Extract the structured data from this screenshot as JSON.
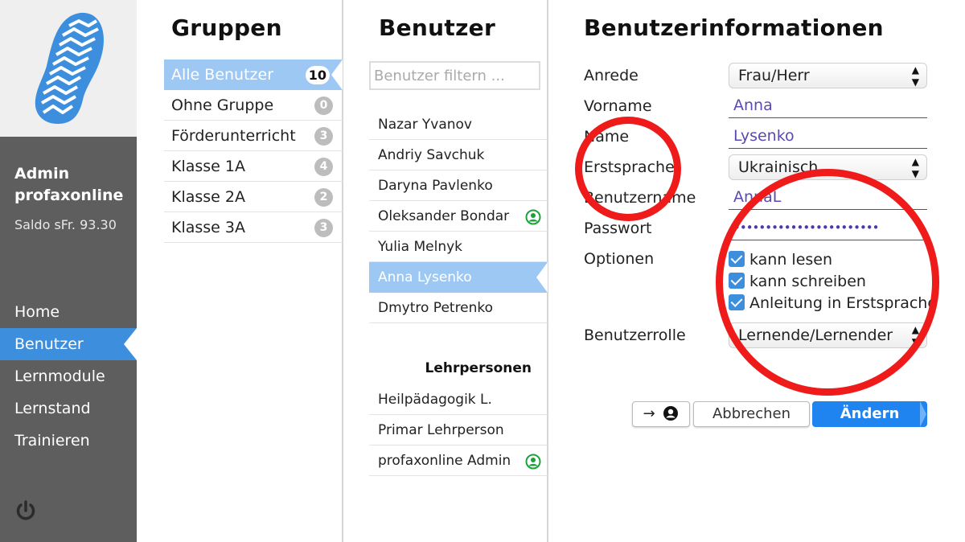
{
  "sidebar": {
    "user_line1": "Admin",
    "user_line2": "profaxonline",
    "balance": "Saldo sFr. 93.30",
    "nav": [
      {
        "label": "Home",
        "active": false
      },
      {
        "label": "Benutzer",
        "active": true
      },
      {
        "label": "Lernmodule",
        "active": false
      },
      {
        "label": "Lernstand",
        "active": false
      },
      {
        "label": "Trainieren",
        "active": false
      }
    ],
    "accent": "#3d8fde"
  },
  "groups": {
    "title": "Gruppen",
    "items": [
      {
        "label": "Alle Benutzer",
        "count": "10",
        "active": true
      },
      {
        "label": "Ohne Gruppe",
        "count": "0"
      },
      {
        "label": "Förderunterricht",
        "count": "3"
      },
      {
        "label": "Klasse 1A",
        "count": "4"
      },
      {
        "label": "Klasse 2A",
        "count": "2"
      },
      {
        "label": "Klasse 3A",
        "count": "3"
      }
    ]
  },
  "users": {
    "title": "Benutzer",
    "filter_placeholder": "Benutzer filtern ...",
    "items": [
      {
        "label": "Nazar Yvanov"
      },
      {
        "label": "Andriy Savchuk"
      },
      {
        "label": "Daryna Pavlenko"
      },
      {
        "label": "Oleksander Bondar",
        "online": true
      },
      {
        "label": "Yulia Melnyk"
      },
      {
        "label": "Anna Lysenko",
        "active": true
      },
      {
        "label": "Dmytro Petrenko"
      }
    ],
    "teachers_title": "Lehrpersonen",
    "teachers": [
      {
        "label": "Heilpädagogik L."
      },
      {
        "label": "Primar Lehrperson"
      },
      {
        "label": "profaxonline Admin",
        "online": true
      }
    ]
  },
  "form": {
    "title": "Benutzerinformationen",
    "labels": {
      "salutation": "Anrede",
      "firstname": "Vorname",
      "name": "Name",
      "language": "Erstsprache",
      "username": "Benutzername",
      "password": "Passwort",
      "options": "Optionen",
      "role": "Benutzerrolle"
    },
    "values": {
      "salutation": "Frau/Herr",
      "firstname": "Anna",
      "name": "Lysenko",
      "language": "Ukrainisch",
      "username": "AnnaL",
      "password": "•••••••••••••••••••••••",
      "role": "Lernende/Lernender"
    },
    "options": [
      {
        "label": "kann lesen",
        "checked": true
      },
      {
        "label": "kann schreiben",
        "checked": true
      },
      {
        "label": "Anleitung in Erstsprache",
        "checked": true
      }
    ],
    "buttons": {
      "assign": "→",
      "cancel": "Abbrechen",
      "change": "Ändern"
    }
  }
}
